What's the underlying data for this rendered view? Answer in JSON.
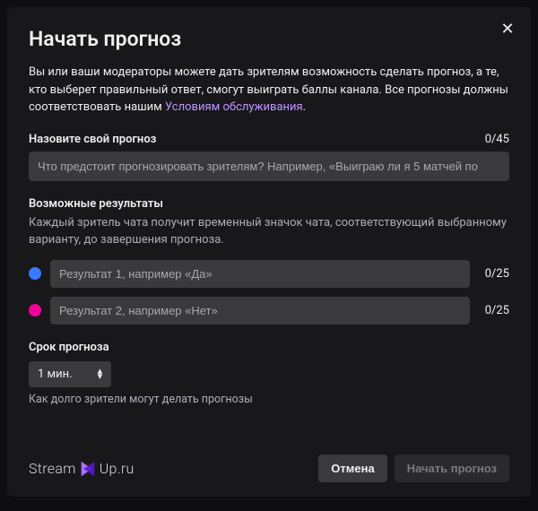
{
  "title": "Начать прогноз",
  "desc_part1": "Вы или ваши модераторы можете дать зрителям возможность сделать прогноз, а те, кто выберет правильный ответ, смогут выиграть баллы канала. Все прогнозы должны соответствовать нашим ",
  "desc_link": "Условиям обслуживания",
  "desc_part2": ".",
  "name_section": {
    "label": "Назовите свой прогноз",
    "counter": "0/45",
    "placeholder": "Что предстоит прогнозировать зрителям? Например, «Выиграю ли я 5 матчей по"
  },
  "outcomes_section": {
    "label": "Возможные результаты",
    "hint": "Каждый зритель чата получит временный значок чата, соответствующий выбранному варианту, до завершения прогноза.",
    "items": [
      {
        "placeholder": "Результат 1, например «Да»",
        "counter": "0/25"
      },
      {
        "placeholder": "Результат 2, например «Нет»",
        "counter": "0/25"
      }
    ]
  },
  "duration_section": {
    "label": "Срок прогноза",
    "value": "1 мин.",
    "hint": "Как долго зрители могут делать прогнозы"
  },
  "footer": {
    "logo_left": "Stream",
    "logo_right": "Up.ru",
    "cancel": "Отмена",
    "start": "Начать прогноз"
  }
}
